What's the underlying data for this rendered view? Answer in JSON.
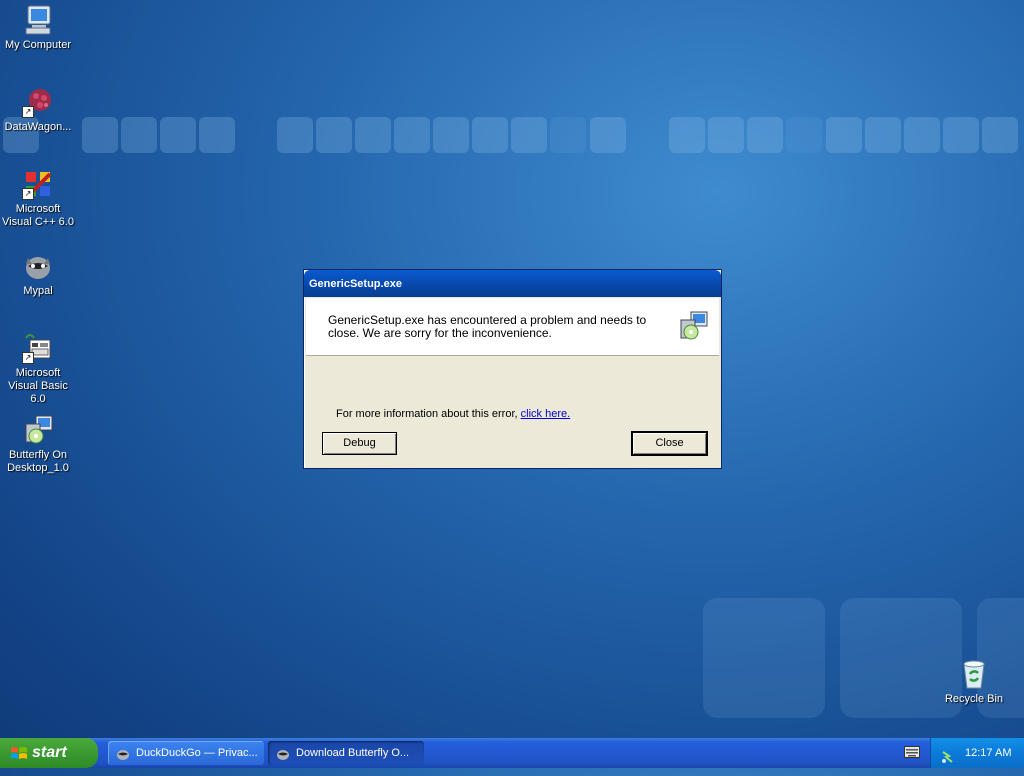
{
  "desktop": {
    "icons": [
      {
        "label": "My Computer",
        "icon": "my-computer-icon"
      },
      {
        "label": "DataWagon...",
        "icon": "datawagon-icon"
      },
      {
        "label": "Microsoft Visual C++ 6.0",
        "icon": "visual-cpp-icon"
      },
      {
        "label": "Mypal",
        "icon": "mypal-icon"
      },
      {
        "label": "Microsoft Visual Basic 6.0",
        "icon": "visual-basic-icon"
      },
      {
        "label": "Butterfly On Desktop_1.0",
        "icon": "installer-icon"
      },
      {
        "label": "Recycle Bin",
        "icon": "recycle-bin-icon"
      }
    ]
  },
  "dialog": {
    "title": "GenericSetup.exe",
    "message": "GenericSetup.exe has encountered a problem and needs to close.  We are sorry for the inconvenience.",
    "info_prefix": "For more information about this error, ",
    "info_link": "click here.",
    "debug_label": "Debug",
    "close_label": "Close"
  },
  "taskbar": {
    "start_label": "start",
    "items": [
      {
        "label": "DuckDuckGo — Privac..."
      },
      {
        "label": "Download Butterfly O..."
      }
    ],
    "clock": "12:17 AM"
  },
  "colors": {
    "desktop": "#2466ad",
    "taskbar": "#245edb",
    "start_button": "#3a9a30",
    "dialog_title": "#0a5bd0"
  }
}
